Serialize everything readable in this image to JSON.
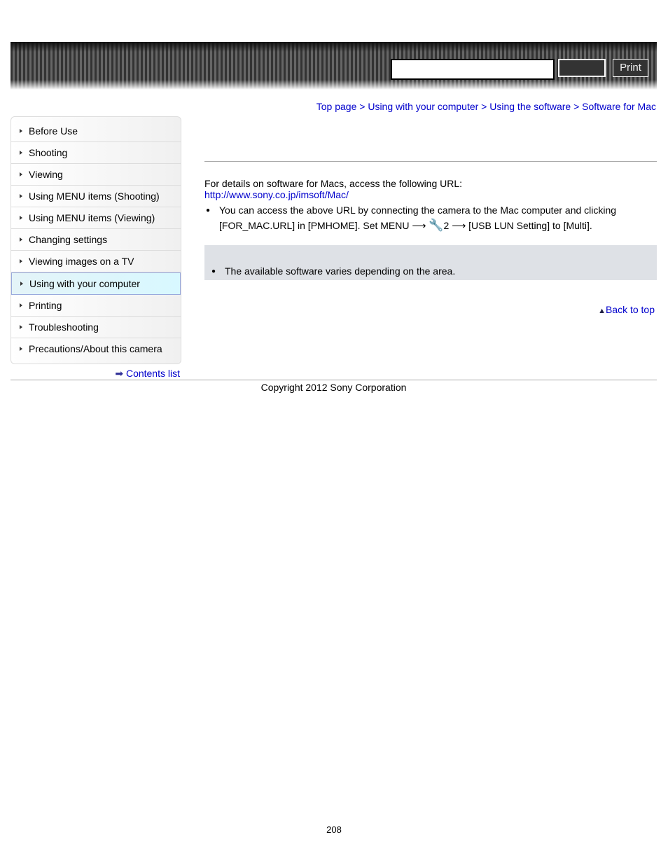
{
  "header": {
    "search_value": "",
    "print_label": "Print"
  },
  "breadcrumb": [
    "Top page",
    "Using with your computer",
    "Using the software",
    "Software for Mac"
  ],
  "breadcrumb_sep": " > ",
  "sidebar": {
    "items": [
      {
        "label": "Before Use"
      },
      {
        "label": "Shooting"
      },
      {
        "label": "Viewing"
      },
      {
        "label": "Using MENU items (Shooting)"
      },
      {
        "label": "Using MENU items (Viewing)"
      },
      {
        "label": "Changing settings"
      },
      {
        "label": "Viewing images on a TV"
      },
      {
        "label": "Using with your computer",
        "selected": true
      },
      {
        "label": "Printing"
      },
      {
        "label": "Troubleshooting"
      },
      {
        "label": "Precautions/About this camera"
      }
    ],
    "contents_list": "Contents list"
  },
  "main": {
    "intro": "For details on software for Macs, access the following URL:",
    "url": "http://www.sony.co.jp/imsoft/Mac/",
    "bullet1_a": "You can access the above URL by connecting the camera to the Mac computer and clicking [FOR_MAC.URL] in [PMHOME]. Set MENU ",
    "arrow": "⟶",
    "setup_num": "2",
    "bullet1_b": " [USB LUN Setting] to [Multi].",
    "note": "The available software varies depending on the area."
  },
  "back_to_top": "Back to top",
  "footer": {
    "copyright": "Copyright 2012 Sony Corporation"
  },
  "page_number": "208"
}
